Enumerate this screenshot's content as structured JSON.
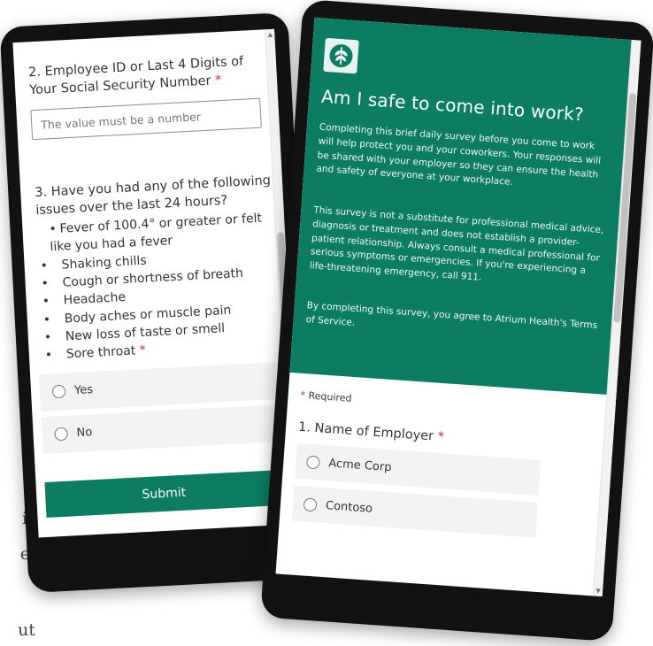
{
  "background_text": [
    "o",
    "ir",
    "e.",
    "ut"
  ],
  "left_form": {
    "q2": {
      "title": "2. Employee ID or Last 4 Digits of Your Social Security Number",
      "required_mark": "*",
      "placeholder": "The value must be a number"
    },
    "q3": {
      "title": "3. Have you had any of the following issues over the last 24 hours?",
      "items": [
        "Fever of 100.4° or greater or felt like you had a fever",
        "Shaking chills",
        "Cough or shortness of breath",
        "Headache",
        "Body aches or muscle pain",
        "New loss of taste or smell",
        "Sore throat"
      ],
      "bullet": "•",
      "required_mark": "*",
      "options": [
        "Yes",
        "No"
      ]
    },
    "submit_label": "Submit"
  },
  "right_form": {
    "title": "Am I safe to come into work?",
    "intro": "Completing this brief daily survey before you come to work will help protect you and your coworkers. Your responses will be shared with your employer so they can ensure the health and safety of everyone at your workplace.",
    "disclaimer": "This survey is not a substitute for professional medical advice, diagnosis or treatment and does not establish a provider-patient relationship. Always consult a medical professional for serious symptoms or emergencies. If you're experiencing a life-threatening emergency, call 911.",
    "agreement": "By completing this survey, you agree to Atrium Health's Terms of Service.",
    "required_mark": "*",
    "required_note": "Required",
    "q1": {
      "title": "1. Name of Employer",
      "required_mark": "*",
      "options": [
        "Acme Corp",
        "Contoso"
      ]
    }
  },
  "colors": {
    "brand_green": "#0c7d63",
    "required_red": "#c4314b",
    "option_bg": "#f2f2f2"
  },
  "icons": [
    "tree-logo-icon",
    "scroll-up-icon",
    "scroll-down-icon",
    "radio-icon"
  ]
}
